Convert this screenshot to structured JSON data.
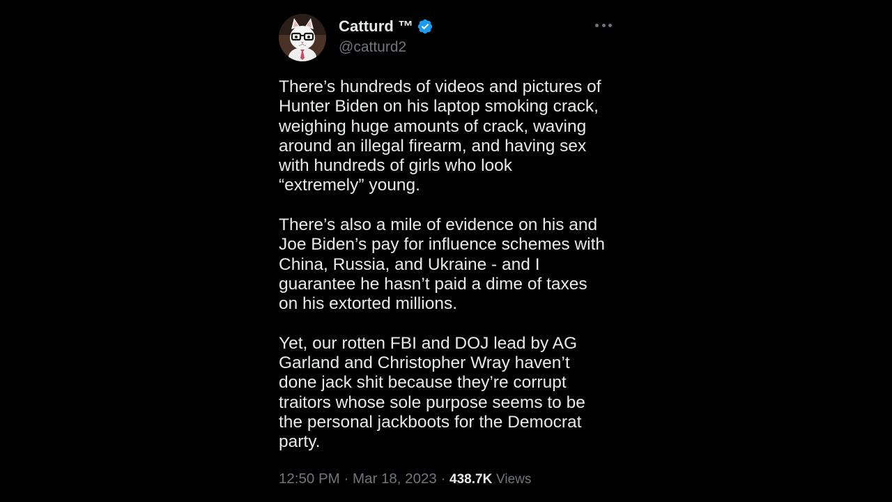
{
  "tweet": {
    "display_name": "Catturd ™",
    "handle": "@catturd2",
    "verified_color": "#1d9bf0",
    "paragraphs": [
      [
        "There’s hundreds of videos and pictures  of",
        "Hunter Biden on his laptop smoking crack,",
        "weighing huge amounts of crack, waving",
        "around an illegal firearm, and having sex",
        "with hundreds of girls who look",
        "“extremely” young."
      ],
      [
        "There’s also a mile of evidence on his and",
        "Joe Biden’s pay for influence schemes with",
        "China, Russia, and Ukraine - and I",
        "guarantee he hasn’t paid a dime of taxes",
        "on his extorted millions."
      ],
      [
        "Yet, our rotten FBI and DOJ lead by AG",
        "Garland and Christopher Wray haven’t",
        "done jack shit because they’re corrupt",
        "traitors whose sole purpose seems to be",
        "the personal jackboots for the Democrat",
        "party."
      ]
    ],
    "time": "12:50 PM",
    "date": "Mar 18, 2023",
    "separator": "·",
    "views_count": "438.7K",
    "views_label": "Views"
  },
  "icons": {
    "avatar": "cat-with-glasses-avatar",
    "verified": "verified-badge-icon",
    "more": "more-options-icon"
  }
}
